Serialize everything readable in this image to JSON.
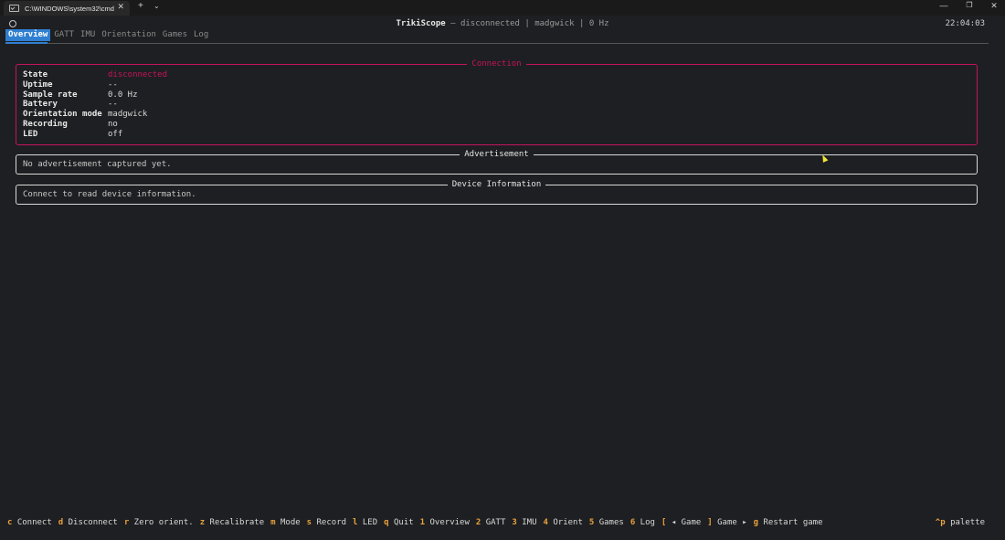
{
  "window": {
    "tab_title": "C:\\WINDOWS\\system32\\cmd.",
    "close_glyph": "✕",
    "new_tab_glyph": "+",
    "dropdown_glyph": "⌄",
    "minimize_glyph": "—",
    "maximize_glyph": "❐",
    "win_close_glyph": "✕"
  },
  "header": {
    "app_name": "TrikiScope",
    "status": " – disconnected | madgwick | 0 Hz",
    "clock": "22:04:03"
  },
  "tabs": [
    {
      "label": "Overview",
      "active": true
    },
    {
      "label": "GATT",
      "active": false
    },
    {
      "label": "IMU",
      "active": false
    },
    {
      "label": "Orientation",
      "active": false
    },
    {
      "label": "Games",
      "active": false
    },
    {
      "label": "Log",
      "active": false
    }
  ],
  "connection": {
    "title": "Connection",
    "rows": [
      {
        "key": "State",
        "value": "disconnected"
      },
      {
        "key": "Uptime",
        "value": "--"
      },
      {
        "key": "Sample rate",
        "value": "0.0 Hz"
      },
      {
        "key": "Battery",
        "value": "--"
      },
      {
        "key": "Orientation mode",
        "value": "madgwick"
      },
      {
        "key": "Recording",
        "value": "no"
      },
      {
        "key": "LED",
        "value": "off"
      }
    ]
  },
  "advertisement": {
    "title": "Advertisement",
    "message": "No advertisement captured yet."
  },
  "device_info": {
    "title": "Device Information",
    "message": "Connect to read device information."
  },
  "footer": {
    "bindings": [
      {
        "key": "c",
        "label": "Connect"
      },
      {
        "key": "d",
        "label": "Disconnect"
      },
      {
        "key": "r",
        "label": "Zero orient."
      },
      {
        "key": "z",
        "label": "Recalibrate"
      },
      {
        "key": "m",
        "label": "Mode"
      },
      {
        "key": "s",
        "label": "Record"
      },
      {
        "key": "l",
        "label": "LED"
      },
      {
        "key": "q",
        "label": "Quit"
      },
      {
        "key": "1",
        "label": "Overview"
      },
      {
        "key": "2",
        "label": "GATT"
      },
      {
        "key": "3",
        "label": "IMU"
      },
      {
        "key": "4",
        "label": "Orient"
      },
      {
        "key": "5",
        "label": "Games"
      },
      {
        "key": "6",
        "label": "Log"
      },
      {
        "key": "[",
        "label": "◂ Game"
      },
      {
        "key": "]",
        "label": "Game ▸"
      },
      {
        "key": "g",
        "label": "Restart game"
      }
    ],
    "palette_key": "^p",
    "palette_label": "palette"
  },
  "colors": {
    "accent": "#2f7fd1",
    "connection_border": "#c4145c",
    "key_hint": "#e8a23c"
  }
}
